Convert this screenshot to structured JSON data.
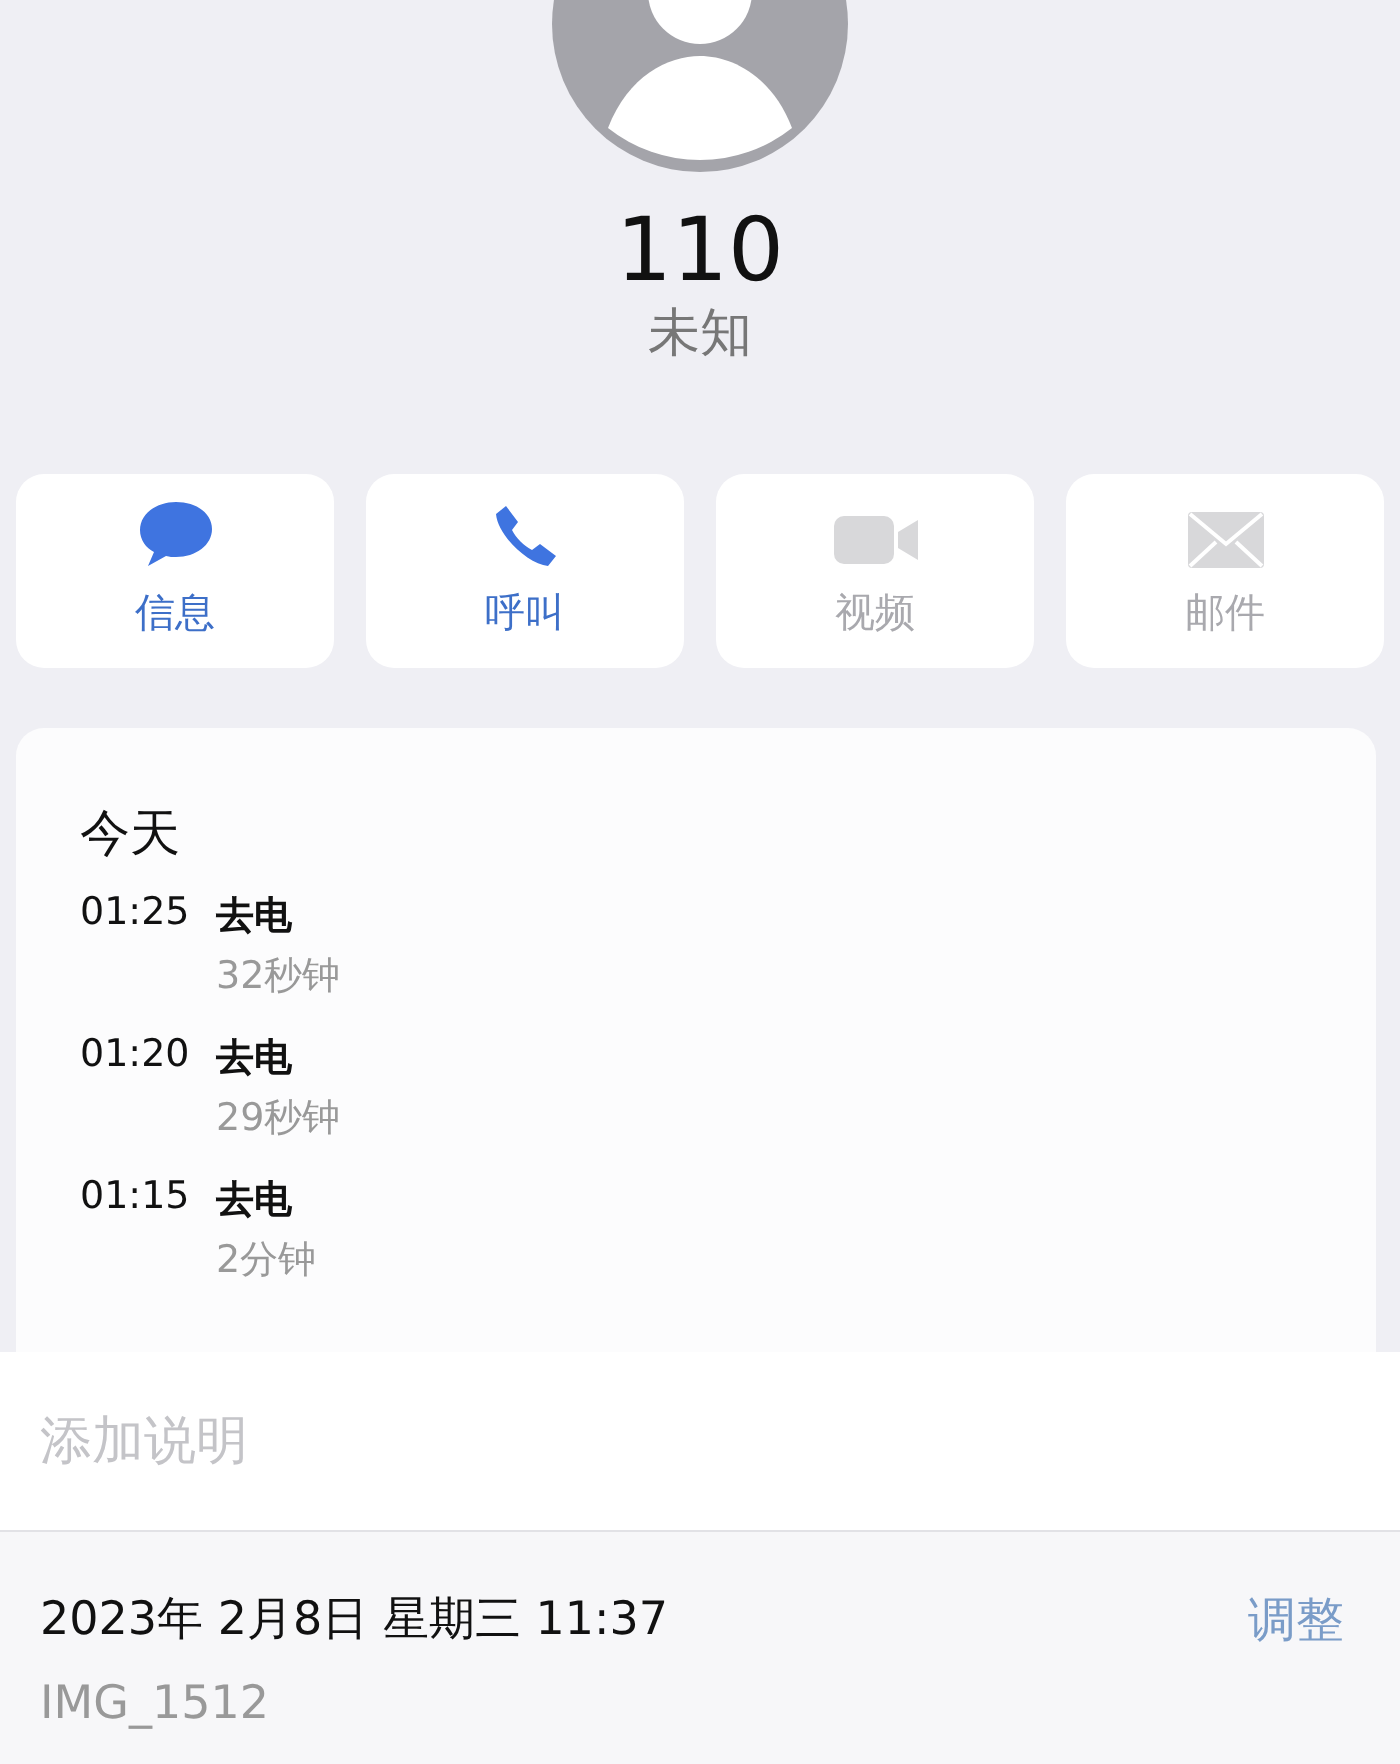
{
  "contact": {
    "number": "110",
    "label": "未知"
  },
  "actions": [
    {
      "kind": "message",
      "label": "信息",
      "disabled": false
    },
    {
      "kind": "call",
      "label": "呼叫",
      "disabled": false
    },
    {
      "kind": "video",
      "label": "视频",
      "disabled": true
    },
    {
      "kind": "mail",
      "label": "邮件",
      "disabled": true
    }
  ],
  "call_log": {
    "heading": "今天",
    "entries": [
      {
        "time": "01:25",
        "type": "去电",
        "duration": "32秒钟"
      },
      {
        "time": "01:20",
        "type": "去电",
        "duration": "29秒钟"
      },
      {
        "time": "01:15",
        "type": "去电",
        "duration": "2分钟"
      }
    ]
  },
  "caption": {
    "placeholder": "添加说明"
  },
  "photo_info": {
    "date": "2023年 2月8日 星期三 11:37",
    "filename": "IMG_1512",
    "adjust_button": "调整"
  }
}
